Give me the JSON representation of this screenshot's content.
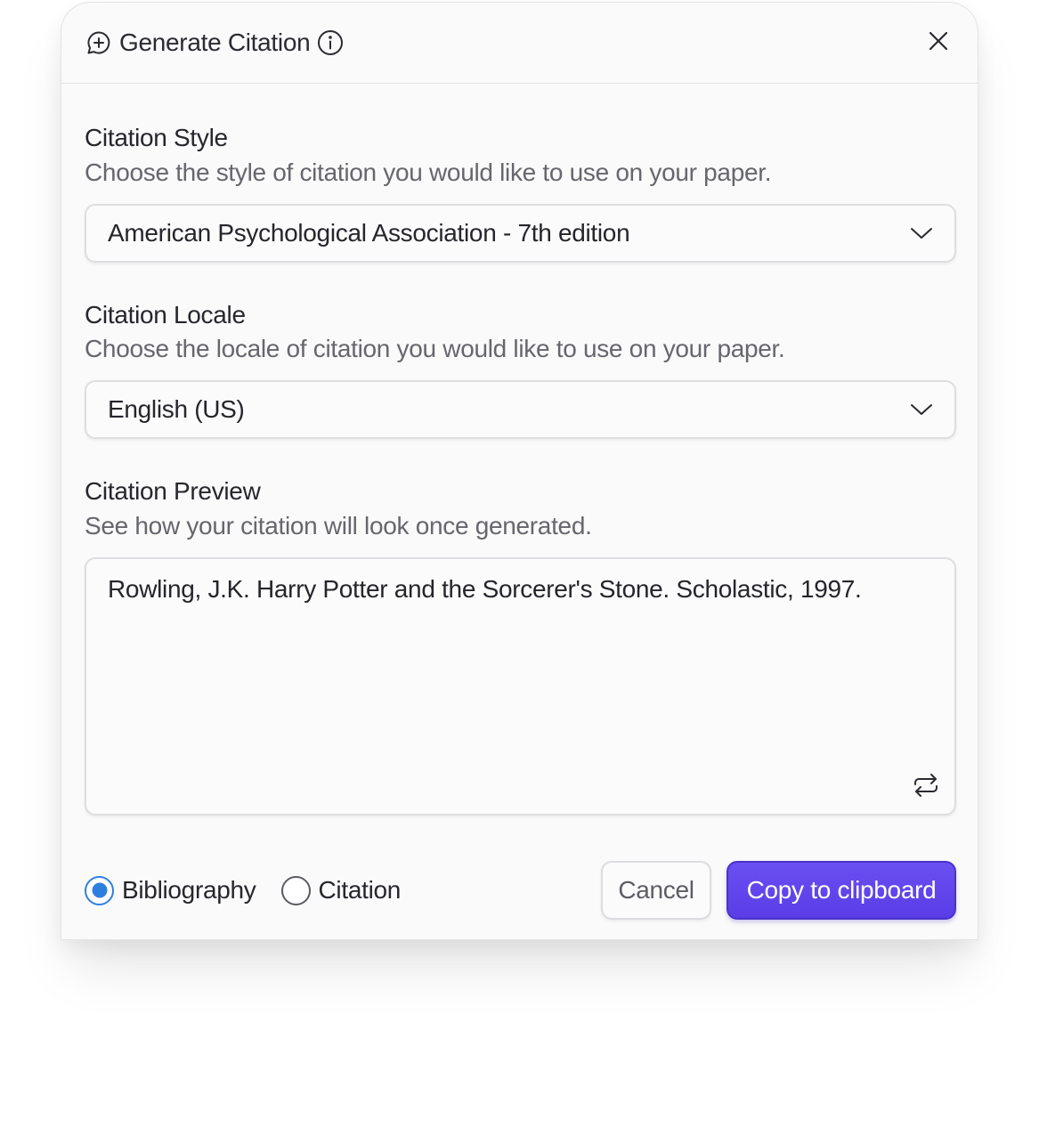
{
  "dialog": {
    "title": "Generate Citation"
  },
  "style_section": {
    "title": "Citation Style",
    "description": "Choose the style of citation you would like to use on your paper.",
    "selected": "American Psychological Association - 7th edition"
  },
  "locale_section": {
    "title": "Citation Locale",
    "description": "Choose the locale of citation you would like to use on your paper.",
    "selected": "English (US)"
  },
  "preview_section": {
    "title": "Citation Preview",
    "description": "See how your citation will look once generated.",
    "text": "Rowling, J.K. Harry Potter and the Sorcerer's Stone. Scholastic, 1997."
  },
  "format_options": [
    {
      "label": "Bibliography",
      "checked": true
    },
    {
      "label": "Citation",
      "checked": false
    }
  ],
  "actions": {
    "cancel_label": "Cancel",
    "copy_label": "Copy to clipboard"
  },
  "colors": {
    "accent": "#5a3de6",
    "radio_selected": "#2f7fe0"
  },
  "icons": {
    "title_icon": "message-plus-icon",
    "info_icon": "info-icon",
    "close_icon": "close-icon",
    "chevron_icon": "chevron-down-icon",
    "refresh_icon": "repeat-icon"
  }
}
